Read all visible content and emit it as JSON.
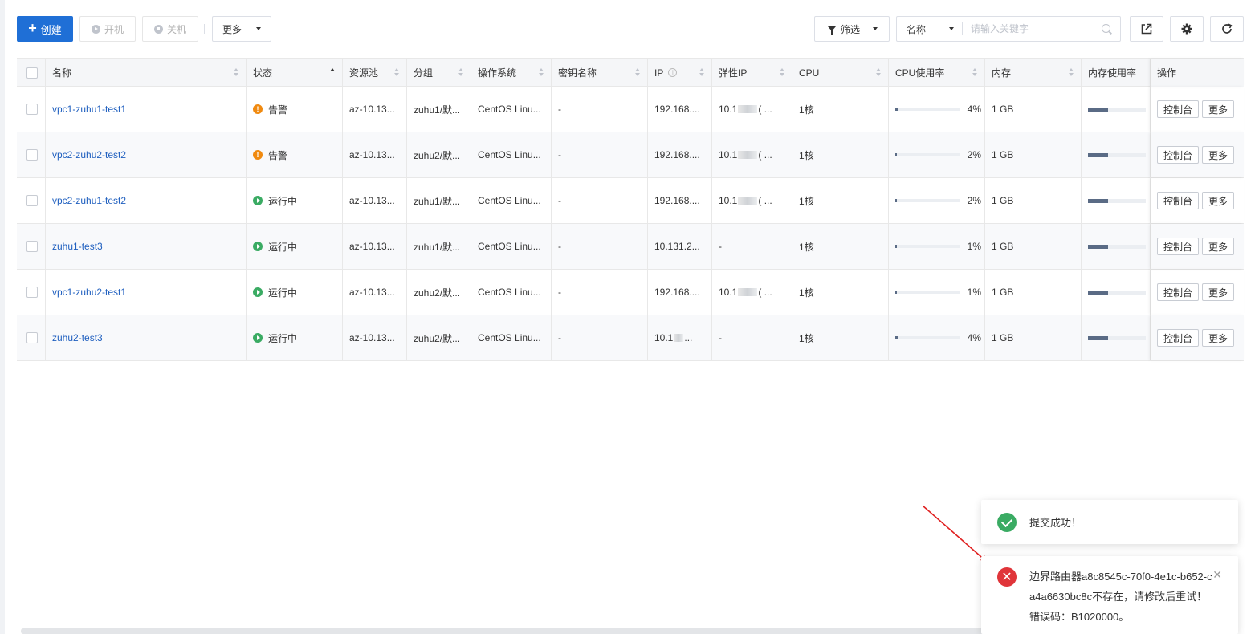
{
  "toolbar": {
    "create_label": "创建",
    "start_label": "开机",
    "shutdown_label": "关机",
    "more_label": "更多",
    "filter_label": "筛选",
    "search_field_label": "名称",
    "search_placeholder": "请输入关键字"
  },
  "table": {
    "columns": [
      "名称",
      "状态",
      "资源池",
      "分组",
      "操作系统",
      "密钥名称",
      "IP",
      "弹性IP",
      "CPU",
      "CPU使用率",
      "内存",
      "内存使用率",
      "操作"
    ],
    "rows": [
      {
        "name": "vpc1-zuhu1-test1",
        "status": "告警",
        "status_type": "warning",
        "pool": "az-10.13...",
        "group": "zuhu1/默...",
        "os": "CentOS Linu...",
        "key": "-",
        "ip": "192.168....",
        "eip_prefix": "10.1",
        "eip_suffix": "( ...",
        "cpu": "1核",
        "cpu_usage": "4%",
        "cpu_fraction": 0.04,
        "mem": "1 GB",
        "mem_fraction": 0.35,
        "op_console": "控制台",
        "op_more": "更多"
      },
      {
        "name": "vpc2-zuhu2-test2",
        "status": "告警",
        "status_type": "warning",
        "pool": "az-10.13...",
        "group": "zuhu2/默...",
        "os": "CentOS Linu...",
        "key": "-",
        "ip": "192.168....",
        "eip_prefix": "10.1",
        "eip_suffix": "( ...",
        "cpu": "1核",
        "cpu_usage": "2%",
        "cpu_fraction": 0.02,
        "mem": "1 GB",
        "mem_fraction": 0.35,
        "op_console": "控制台",
        "op_more": "更多"
      },
      {
        "name": "vpc2-zuhu1-test2",
        "status": "运行中",
        "status_type": "running",
        "pool": "az-10.13...",
        "group": "zuhu1/默...",
        "os": "CentOS Linu...",
        "key": "-",
        "ip": "192.168....",
        "eip_prefix": "10.1",
        "eip_suffix": "( ...",
        "cpu": "1核",
        "cpu_usage": "2%",
        "cpu_fraction": 0.02,
        "mem": "1 GB",
        "mem_fraction": 0.35,
        "op_console": "控制台",
        "op_more": "更多"
      },
      {
        "name": "zuhu1-test3",
        "status": "运行中",
        "status_type": "running",
        "pool": "az-10.13...",
        "group": "zuhu1/默...",
        "os": "CentOS Linu...",
        "key": "-",
        "ip": "10.131.2...",
        "eip_prefix": "-",
        "eip_suffix": "",
        "cpu": "1核",
        "cpu_usage": "1%",
        "cpu_fraction": 0.01,
        "mem": "1 GB",
        "mem_fraction": 0.35,
        "op_console": "控制台",
        "op_more": "更多"
      },
      {
        "name": "vpc1-zuhu2-test1",
        "status": "运行中",
        "status_type": "running",
        "pool": "az-10.13...",
        "group": "zuhu2/默...",
        "os": "CentOS Linu...",
        "key": "-",
        "ip": "192.168....",
        "eip_prefix": "10.1",
        "eip_suffix": "( ...",
        "cpu": "1核",
        "cpu_usage": "1%",
        "cpu_fraction": 0.01,
        "mem": "1 GB",
        "mem_fraction": 0.35,
        "op_console": "控制台",
        "op_more": "更多"
      },
      {
        "name": "zuhu2-test3",
        "status": "运行中",
        "status_type": "running",
        "pool": "az-10.13...",
        "group": "zuhu2/默...",
        "os": "CentOS Linu...",
        "key": "-",
        "ip": "10.1",
        "ip_suffix": "...",
        "eip_prefix": "-",
        "eip_suffix": "",
        "cpu": "1核",
        "cpu_usage": "4%",
        "cpu_fraction": 0.04,
        "mem": "1 GB",
        "mem_fraction": 0.35,
        "op_console": "控制台",
        "op_more": "更多"
      }
    ]
  },
  "toasts": {
    "success": "提交成功！",
    "error": "边界路由器a8c8545c-70f0-4e1c-b652-ca4a6630bc8c不存在，请修改后重试！错误码：B1020000。"
  },
  "colors": {
    "primary": "#1f6fd6",
    "link": "#1f5fbf",
    "warning": "#f08a10",
    "running": "#3aab63",
    "error": "#e0353a",
    "annotation_arrow": "#e02020"
  }
}
